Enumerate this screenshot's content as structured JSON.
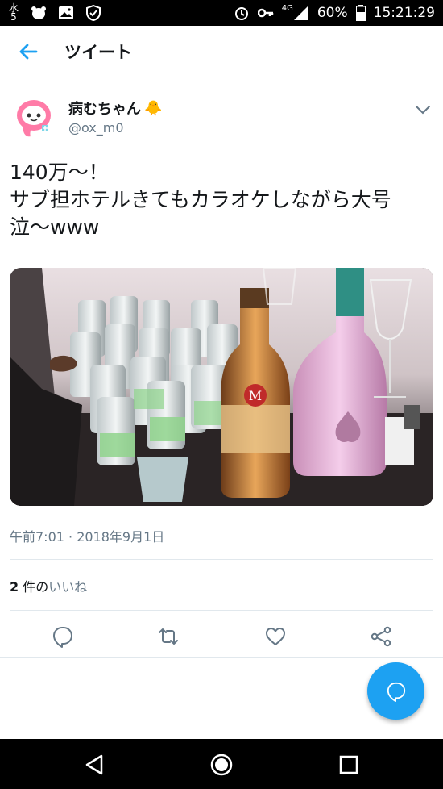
{
  "status_bar": {
    "left_char_top": "水",
    "left_char_bottom": "5",
    "network": "4G",
    "battery": "60%",
    "time": "15:21:29",
    "icons": [
      "bear-icon",
      "image-icon",
      "shield-icon",
      "alarm-icon",
      "key-icon",
      "signal-icon",
      "battery-icon"
    ]
  },
  "header": {
    "title": "ツイート",
    "back_icon": "arrow-left-icon"
  },
  "tweet": {
    "display_name": "病むちゃん",
    "name_emoji": "🐥",
    "handle": "@ox_m0",
    "text_lines": [
      "140万〜！",
      "サブ担ホテルきてもカラオケしながら大号",
      "泣〜www"
    ],
    "timestamp": "午前7:01 · 2018年9月1日",
    "likes_count": "2",
    "likes_unit": "件の",
    "likes_label": "いいね"
  },
  "actions": [
    "reply-icon",
    "retweet-icon",
    "like-icon",
    "share-icon"
  ],
  "colors": {
    "accent": "#1da1f2",
    "text": "#14171a",
    "muted": "#657786"
  }
}
